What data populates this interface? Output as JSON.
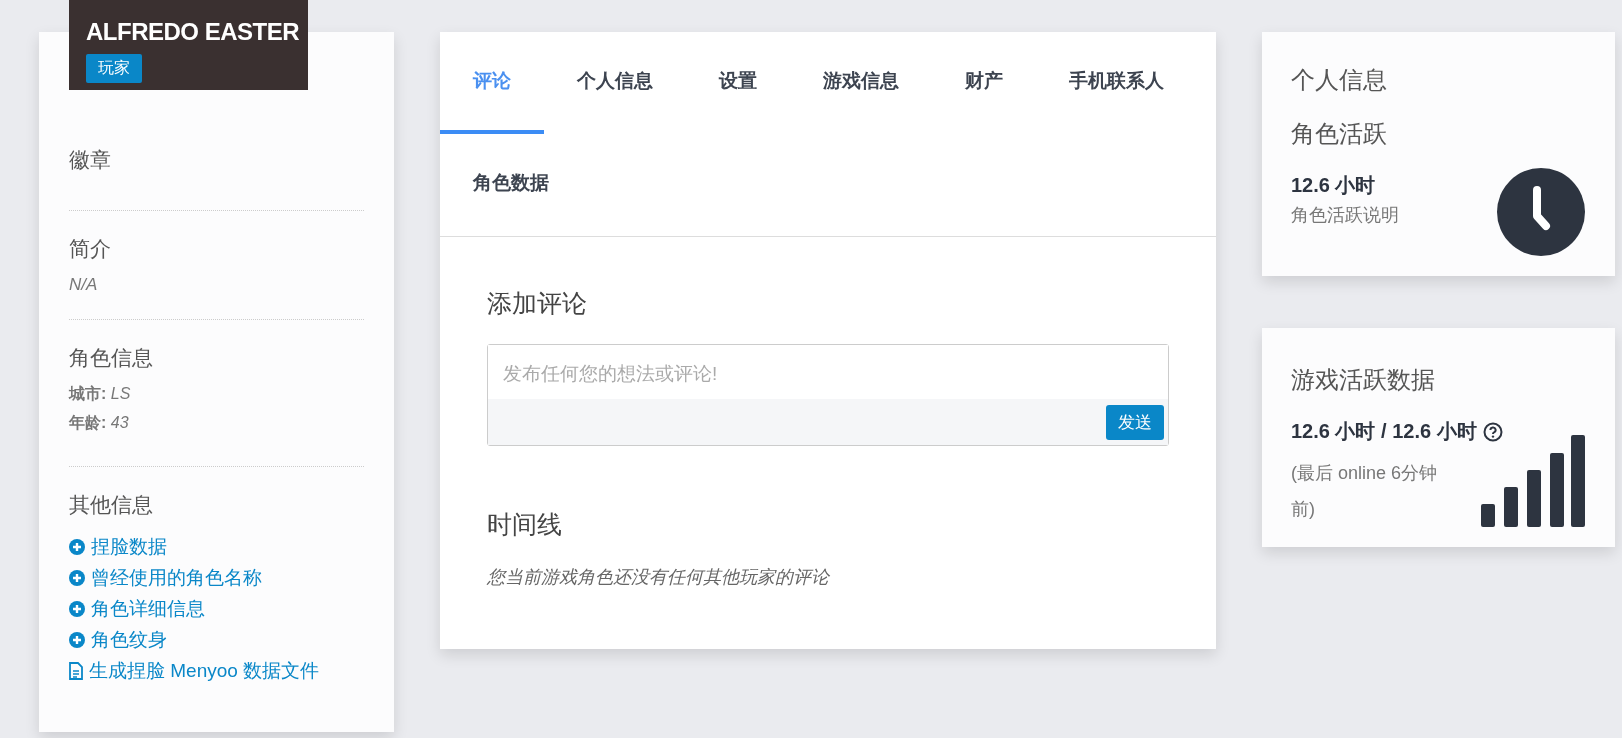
{
  "profile": {
    "name": "ALFREDO EASTER",
    "role_badge": "玩家"
  },
  "sidebar": {
    "sections": [
      {
        "title": "徽章"
      },
      {
        "title": "简介",
        "text": "N/A"
      },
      {
        "title": "角色信息",
        "fields": [
          {
            "label": "城市:",
            "value": "LS"
          },
          {
            "label": "年龄:",
            "value": "43"
          }
        ]
      },
      {
        "title": "其他信息",
        "links": [
          {
            "kind": "plus",
            "label": "捏脸数据"
          },
          {
            "kind": "plus",
            "label": "曾经使用的角色名称"
          },
          {
            "kind": "plus",
            "label": "角色详细信息"
          },
          {
            "kind": "plus",
            "label": "角色纹身"
          },
          {
            "kind": "file",
            "label": "生成捏脸 Menyoo 数据文件"
          }
        ]
      }
    ]
  },
  "tabs": [
    {
      "label": "评论",
      "selected": true
    },
    {
      "label": "个人信息",
      "selected": false
    },
    {
      "label": "设置",
      "selected": false
    },
    {
      "label": "游戏信息",
      "selected": false
    },
    {
      "label": "财产",
      "selected": false
    },
    {
      "label": "手机联系人",
      "selected": false
    },
    {
      "label": "角色数据",
      "selected": false
    }
  ],
  "comments": {
    "title": "添加评论",
    "placeholder": "发布任何您的想法或评论!",
    "send_button": "发送",
    "timeline_title": "时间线",
    "timeline_empty": "您当前游戏角色还没有任何其他玩家的评论"
  },
  "info_card": {
    "title": "个人信息",
    "subtitle": "角色活跃",
    "value": "12.6 小时",
    "description": "角色活跃说明"
  },
  "activity_card": {
    "title": "游戏活跃数据",
    "value": "12.6 小时 / 12.6 小时",
    "note": "(最后 online 6分钟前)"
  }
}
